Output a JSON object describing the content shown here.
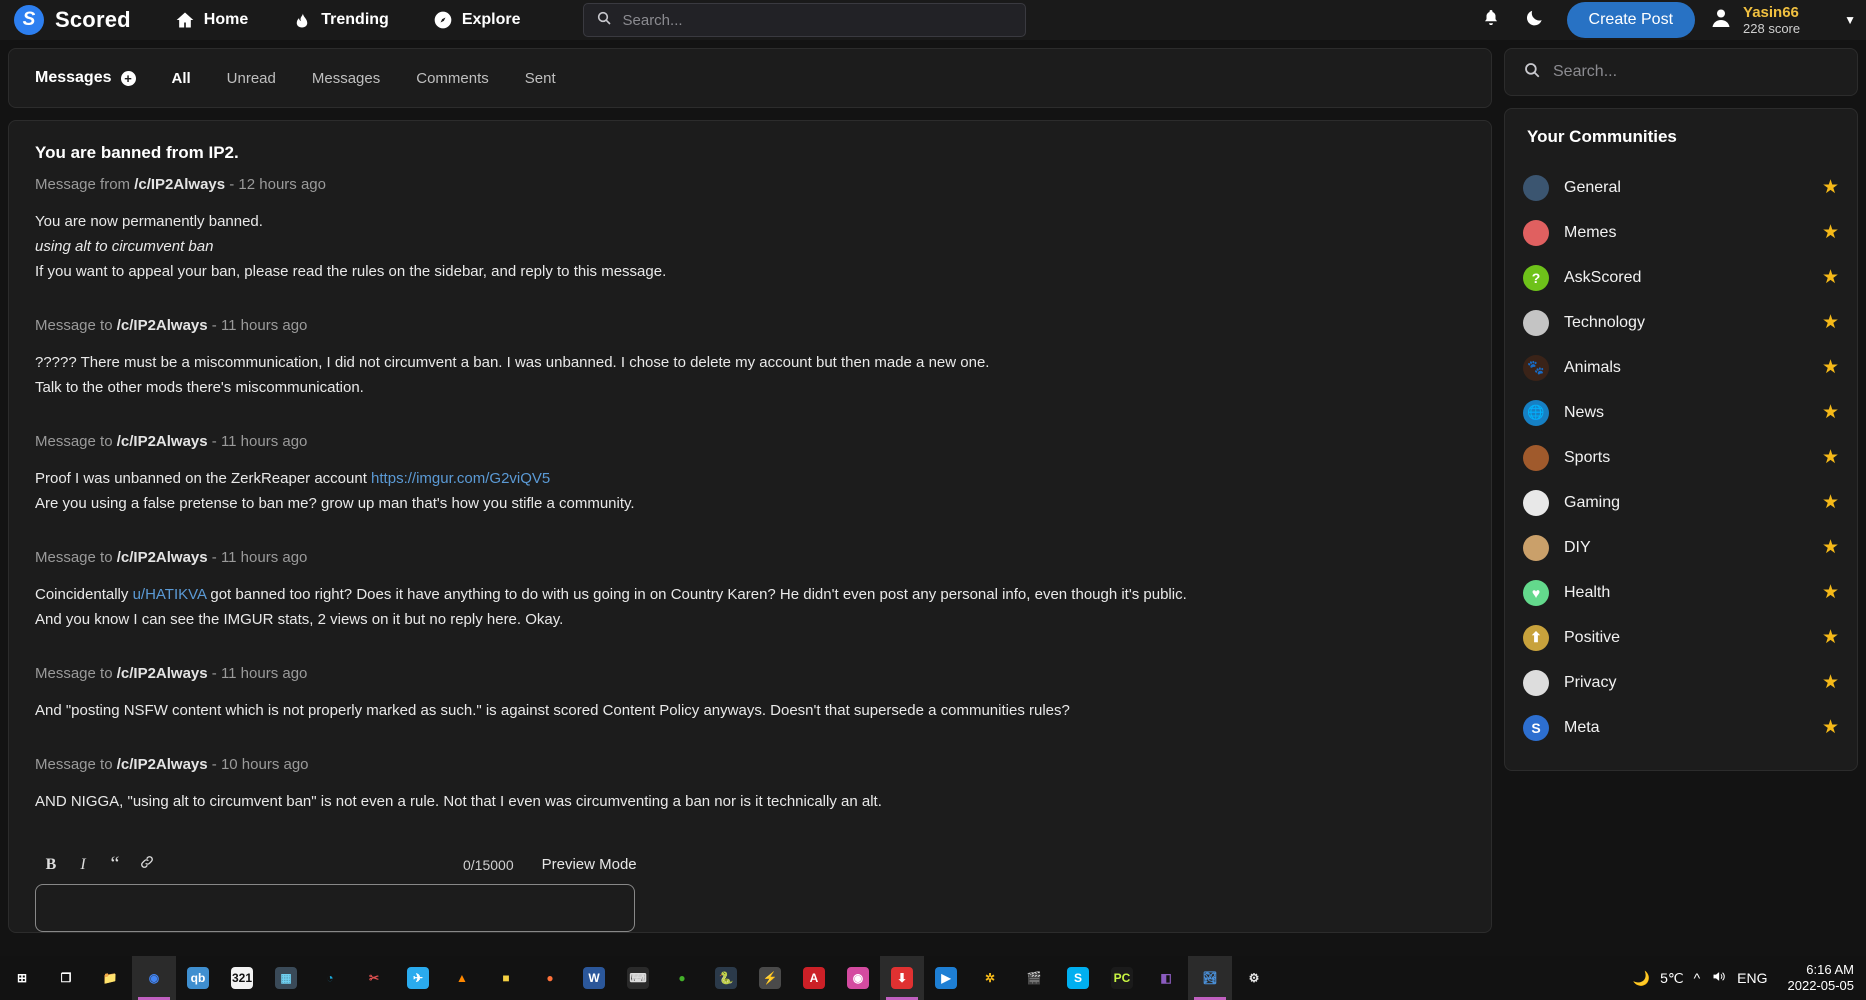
{
  "topnav": {
    "brand": "Scored",
    "logo_icon": "scored-logo-icon",
    "links": [
      {
        "label": "Home",
        "icon": "home-icon"
      },
      {
        "label": "Trending",
        "icon": "flame-icon"
      },
      {
        "label": "Explore",
        "icon": "compass-icon"
      }
    ],
    "search_placeholder": "Search...",
    "search_value": "",
    "bell_icon": "bell-icon",
    "moon_icon": "moon-icon",
    "create_post_label": "Create Post",
    "user_name": "Yasin66",
    "user_score": "228 score",
    "caret": "▼",
    "accent_color": "#2872c4",
    "username_color": "#f0c040"
  },
  "messages_panel": {
    "title": "Messages",
    "compose_icon": "plus-circle-icon",
    "tabs": [
      {
        "label": "All",
        "active": true
      },
      {
        "label": "Unread",
        "active": false
      },
      {
        "label": "Messages",
        "active": false
      },
      {
        "label": "Comments",
        "active": false
      },
      {
        "label": "Sent",
        "active": false
      }
    ]
  },
  "thread": {
    "title": "You are banned from IP2.",
    "messages": [
      {
        "direction": "Message from",
        "community": "/c/IP2Always",
        "time": "- 12 hours ago",
        "lines": [
          {
            "text": "You are now permanently banned.",
            "style": "normal"
          },
          {
            "text": "using alt to circumvent ban",
            "style": "italic"
          },
          {
            "text": "If you want to appeal your ban, please read the rules on the sidebar, and reply to this message.",
            "style": "normal"
          }
        ]
      },
      {
        "direction": "Message to",
        "community": "/c/IP2Always",
        "time": "- 11 hours ago",
        "lines": [
          {
            "text": "????? There must be a miscommunication, I did not circumvent a ban. I was unbanned. I chose to delete my account but then made a new one.",
            "style": "normal"
          },
          {
            "text": "Talk to the other mods there's miscommunication.",
            "style": "normal"
          }
        ]
      },
      {
        "direction": "Message to",
        "community": "/c/IP2Always",
        "time": "- 11 hours ago",
        "lines": [
          {
            "text": "Proof I was unbanned on the ZerkReaper account ",
            "style": "normal",
            "link": "https://imgur.com/G2viQV5"
          },
          {
            "text": "Are you using a false pretense to ban me? grow up man that's how you stifle a community.",
            "style": "normal"
          }
        ]
      },
      {
        "direction": "Message to",
        "community": "/c/IP2Always",
        "time": "- 11 hours ago",
        "lines": [
          {
            "text": "Coincidentally ",
            "style": "normal",
            "inline_link": "u/HATIKVA",
            "text_after": " got banned too right? Does it have anything to do with us going in on Country Karen? He didn't even post any personal info, even though it's public."
          },
          {
            "text": "And you know I can see the IMGUR stats, 2 views on it but no reply here. Okay.",
            "style": "normal"
          }
        ]
      },
      {
        "direction": "Message to",
        "community": "/c/IP2Always",
        "time": "- 11 hours ago",
        "lines": [
          {
            "text": "And \"posting NSFW content which is not properly marked as such.\" is against scored Content Policy anyways. Doesn't that supersede a communities rules?",
            "style": "normal"
          }
        ]
      },
      {
        "direction": "Message to",
        "community": "/c/IP2Always",
        "time": "- 10 hours ago",
        "lines": [
          {
            "text": "AND NIGGA, \"using alt to circumvent ban\" is not even a rule. Not that I even was circumventing a ban nor is it technically an alt.",
            "style": "normal"
          }
        ]
      }
    ]
  },
  "editor": {
    "bold_label": "B",
    "italic_label": "I",
    "quote_label": "“",
    "link_icon": "link-icon",
    "counter": "0/15000",
    "preview_mode_label": "Preview Mode",
    "reply_value": "",
    "reply_placeholder": ""
  },
  "sidebar": {
    "search_placeholder": "Search...",
    "search_value": "",
    "communities_title": "Your Communities",
    "star_color": "#f5b919",
    "communities": [
      {
        "name": "General",
        "icon": "general-avatar",
        "color": "#3b5570",
        "glyph": "",
        "starred": true
      },
      {
        "name": "Memes",
        "icon": "memes-avatar",
        "color": "#e06060",
        "glyph": "",
        "starred": true
      },
      {
        "name": "AskScored",
        "icon": "askscored-avatar",
        "color": "#6ec21a",
        "glyph": "?",
        "starred": true
      },
      {
        "name": "Technology",
        "icon": "technology-avatar",
        "color": "#c4c4c4",
        "glyph": "",
        "starred": true
      },
      {
        "name": "Animals",
        "icon": "animals-avatar",
        "color": "#3a2318",
        "glyph": "🐾",
        "starred": true
      },
      {
        "name": "News",
        "icon": "news-avatar",
        "color": "#1680c4",
        "glyph": "🌐",
        "starred": true
      },
      {
        "name": "Sports",
        "icon": "sports-avatar",
        "color": "#a05a2c",
        "glyph": "",
        "starred": true
      },
      {
        "name": "Gaming",
        "icon": "gaming-avatar",
        "color": "#e8e8e8",
        "glyph": "",
        "starred": true
      },
      {
        "name": "DIY",
        "icon": "diy-avatar",
        "color": "#caa06a",
        "glyph": "",
        "starred": true
      },
      {
        "name": "Health",
        "icon": "health-avatar",
        "color": "#63d98c",
        "glyph": "♥",
        "starred": true
      },
      {
        "name": "Positive",
        "icon": "positive-avatar",
        "color": "#c8a23c",
        "glyph": "⬆",
        "starred": true
      },
      {
        "name": "Privacy",
        "icon": "privacy-avatar",
        "color": "#dddddd",
        "glyph": "",
        "starred": true
      },
      {
        "name": "Meta",
        "icon": "meta-avatar",
        "color": "#2d6fd0",
        "glyph": "S",
        "starred": true
      }
    ]
  },
  "taskbar": {
    "items": [
      {
        "icon": "windows-start-icon",
        "glyph": "⊞",
        "color": "#ffffff",
        "bg": "transparent",
        "active": false
      },
      {
        "icon": "task-view-icon",
        "glyph": "❐",
        "color": "#ffffff",
        "bg": "transparent",
        "active": false
      },
      {
        "icon": "file-explorer-icon",
        "glyph": "📁",
        "color": "#f0b429",
        "bg": "transparent",
        "active": false
      },
      {
        "icon": "google-chrome-icon",
        "glyph": "◉",
        "color": "#4285f4",
        "bg": "transparent",
        "active": true
      },
      {
        "icon": "qbittorrent-icon",
        "glyph": "qb",
        "color": "#ffffff",
        "bg": "#3f8fd0",
        "active": false
      },
      {
        "icon": "mpc-321-icon",
        "glyph": "321",
        "color": "#111111",
        "bg": "#f2f2f2",
        "active": false
      },
      {
        "icon": "calculator-icon",
        "glyph": "▦",
        "color": "#6fd0f0",
        "bg": "#3a4a58",
        "active": false
      },
      {
        "icon": "microsoft-edge-icon",
        "glyph": "◔",
        "color": "#1aa8d8",
        "bg": "transparent",
        "active": false
      },
      {
        "icon": "snipping-tool-icon",
        "glyph": "✂",
        "color": "#e05050",
        "bg": "transparent",
        "active": false
      },
      {
        "icon": "telegram-icon",
        "glyph": "✈",
        "color": "#ffffff",
        "bg": "#2aabee",
        "active": false
      },
      {
        "icon": "vlc-icon",
        "glyph": "▲",
        "color": "#ff8800",
        "bg": "transparent",
        "active": false
      },
      {
        "icon": "sticky-notes-icon",
        "glyph": "■",
        "color": "#f5d142",
        "bg": "transparent",
        "active": false
      },
      {
        "icon": "firefox-icon",
        "glyph": "●",
        "color": "#ff7139",
        "bg": "transparent",
        "active": false
      },
      {
        "icon": "microsoft-word-icon",
        "glyph": "W",
        "color": "#ffffff",
        "bg": "#2b579a",
        "active": false
      },
      {
        "icon": "terminal-icon",
        "glyph": "⌨",
        "color": "#dddddd",
        "bg": "#2a2a2a",
        "active": false
      },
      {
        "icon": "anaconda-icon",
        "glyph": "●",
        "color": "#43b02a",
        "bg": "transparent",
        "active": false
      },
      {
        "icon": "pycharm-icon",
        "glyph": "🐍",
        "color": "#f0db4f",
        "bg": "#2b3a4a",
        "active": false
      },
      {
        "icon": "sublime-text-icon",
        "glyph": "⚡",
        "color": "#ff9800",
        "bg": "#4a4a4a",
        "active": false
      },
      {
        "icon": "adobe-acrobat-icon",
        "glyph": "A",
        "color": "#ffffff",
        "bg": "#cc2027",
        "active": false
      },
      {
        "icon": "itunes-icon",
        "glyph": "◉",
        "color": "#ffffff",
        "bg": "#d44ba0",
        "active": false
      },
      {
        "icon": "downloader-icon",
        "glyph": "⬇",
        "color": "#ffffff",
        "bg": "#e03131",
        "active": true
      },
      {
        "icon": "media-player-icon",
        "glyph": "▶",
        "color": "#ffffff",
        "bg": "#1e7fd4",
        "active": false
      },
      {
        "icon": "xmind-icon",
        "glyph": "✲",
        "color": "#f5b919",
        "bg": "transparent",
        "active": false
      },
      {
        "icon": "video-editor-icon",
        "glyph": "🎬",
        "color": "#cccccc",
        "bg": "transparent",
        "active": false
      },
      {
        "icon": "skype-icon",
        "glyph": "S",
        "color": "#ffffff",
        "bg": "#00aff0",
        "active": false
      },
      {
        "icon": "pycharm-pc-icon",
        "glyph": "PC",
        "color": "#c8f542",
        "bg": "#1b1b1b",
        "active": false
      },
      {
        "icon": "onenote-icon",
        "glyph": "◧",
        "color": "#8b5cbf",
        "bg": "transparent",
        "active": false
      },
      {
        "icon": "photos-icon",
        "glyph": "🏞",
        "color": "#4a90d9",
        "bg": "transparent",
        "active": true
      },
      {
        "icon": "settings-gear-icon",
        "glyph": "⚙",
        "color": "#e8e8e8",
        "bg": "transparent",
        "active": false
      }
    ],
    "tray": {
      "weather_icon": "moon-weather-icon",
      "weather_glyph": "🌙",
      "temperature": "5℃",
      "chevron_icon": "chevron-up-icon",
      "volume_icon": "volume-icon",
      "language": "ENG",
      "time": "6:16 AM",
      "date": "2022-05-05"
    }
  }
}
